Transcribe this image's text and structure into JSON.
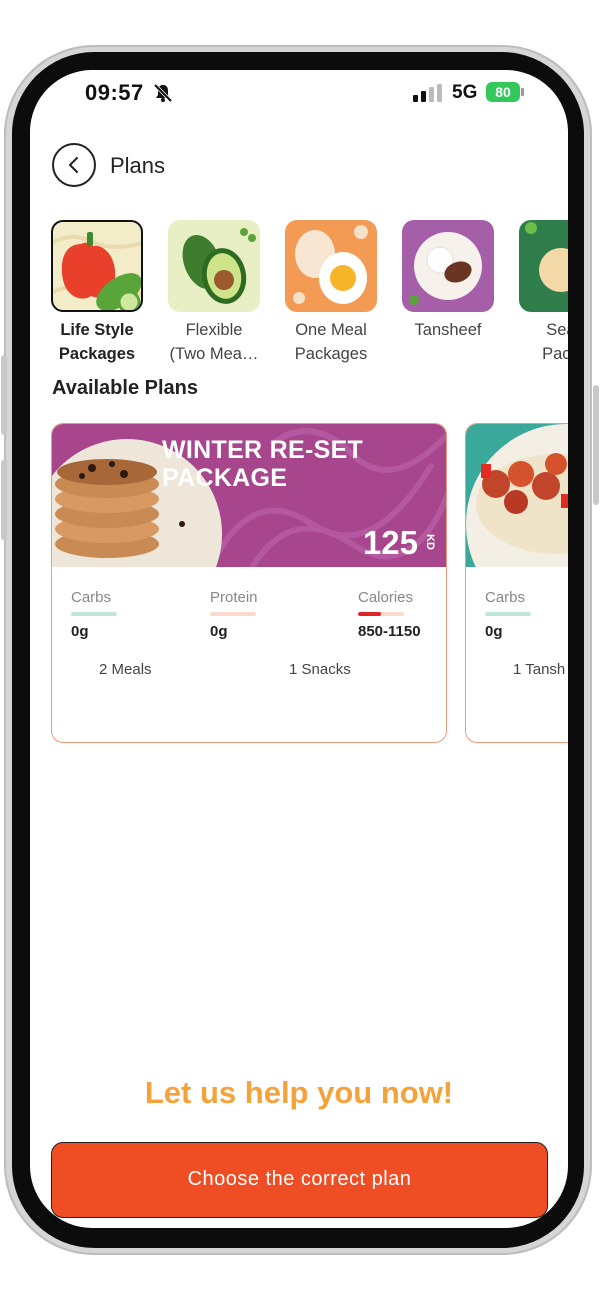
{
  "status_bar": {
    "time": "09:57",
    "network": "5G",
    "battery": "80"
  },
  "header": {
    "title": "Plans"
  },
  "categories": [
    {
      "line1": "Life Style",
      "line2": "Packages",
      "selected": true
    },
    {
      "line1": "Flexible",
      "line2": "(Two Mea…",
      "selected": false
    },
    {
      "line1": "One Meal",
      "line2": "Packages",
      "selected": false
    },
    {
      "line1": "Tansheef",
      "line2": "",
      "selected": false
    },
    {
      "line1": "Seas",
      "line2": "Packa",
      "selected": false
    }
  ],
  "section": {
    "available_plans": "Available Plans"
  },
  "plans": [
    {
      "title_line1": "WINTER RE-SET",
      "title_line2": "PACKAGE",
      "price": "125",
      "currency": "KD",
      "macros": [
        {
          "label": "Carbs",
          "value": "0g",
          "fill": 1.0,
          "color": "#bfe6d8"
        },
        {
          "label": "Protein",
          "value": "0g",
          "fill": 1.0,
          "color": "#fbd9cc"
        },
        {
          "label": "Calories",
          "value": "850-1150",
          "fill": 0.5,
          "color": "#e0242c"
        }
      ],
      "meals": "2 Meals",
      "snacks": "1 Snacks"
    },
    {
      "macros": [
        {
          "label": "Carbs",
          "value": "0g",
          "fill": 1.0,
          "color": "#bfe6d8"
        }
      ],
      "meals": "1 Tansh"
    }
  ],
  "cta": {
    "heading": "Let us help you now!",
    "button": "Choose the correct plan"
  },
  "colors": {
    "accent": "#ef4d24",
    "cta_heading": "#f5a23a",
    "banner": "#a7468c"
  }
}
